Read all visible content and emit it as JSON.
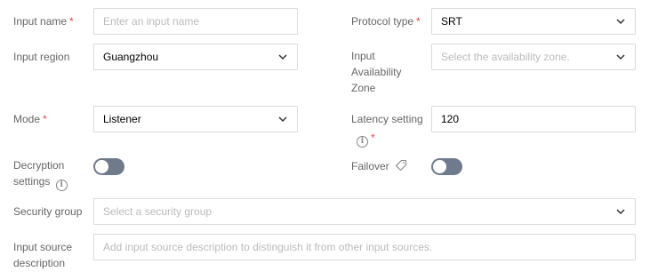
{
  "input_name": {
    "label": "Input name",
    "required": "*",
    "placeholder": "Enter an input name"
  },
  "protocol_type": {
    "label": "Protocol type",
    "required": "*",
    "value": "SRT"
  },
  "input_region": {
    "label": "Input region",
    "value": "Guangzhou"
  },
  "availability_zone": {
    "label_line1": "Input",
    "label_line2": "Availability",
    "label_line3": "Zone",
    "placeholder": "Select the availability zone."
  },
  "mode": {
    "label": "Mode",
    "required": "*",
    "value": "Listener"
  },
  "latency": {
    "label_line1": "Latency setting",
    "required": "*",
    "value": "120"
  },
  "decryption": {
    "label_line1": "Decryption",
    "label_line2": "settings",
    "enabled": false
  },
  "failover": {
    "label": "Failover",
    "enabled": false
  },
  "security_group": {
    "label": "Security group",
    "placeholder": "Select a security group"
  },
  "input_source_description": {
    "label_line1": "Input source",
    "label_line2": "description",
    "placeholder": "Add input source description to distinguish it from other input sources."
  },
  "colors": {
    "required": "#e54545",
    "label": "#666666",
    "placeholder": "#bbbbbb",
    "border": "#dcdcdc",
    "toggle_off": "#6f7a8c"
  },
  "icons": {
    "info": "i"
  }
}
